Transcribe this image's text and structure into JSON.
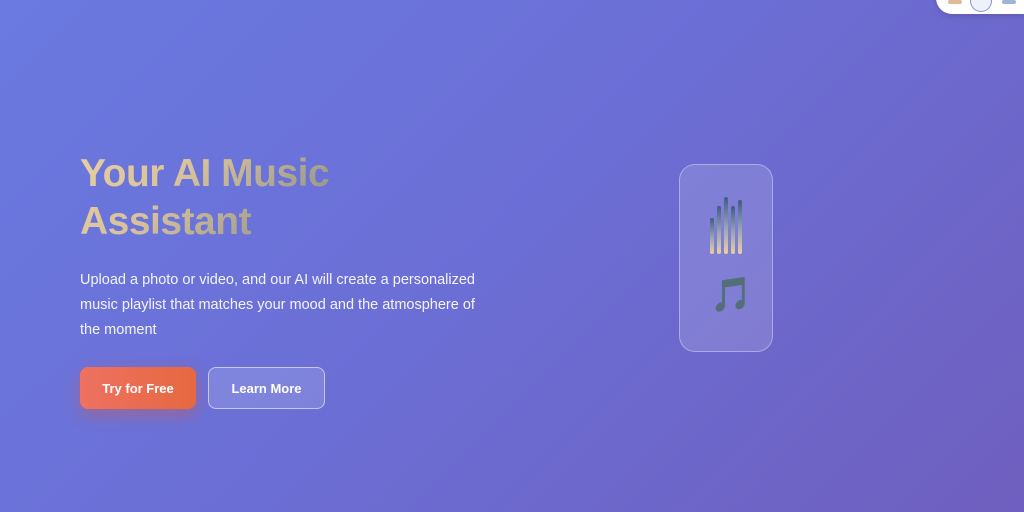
{
  "hero": {
    "title_line1": "Your AI Music",
    "title_line2": "Assistant",
    "subtitle": "Upload a photo or video, and our AI will create a personalized music playlist that matches your mood and the atmosphere of the moment",
    "primary_button": "Try for Free",
    "secondary_button": "Learn More"
  },
  "visual": {
    "note_glyph": "🎵",
    "equalizer_icon": "equalizer-bars",
    "equalizer_levels": [
      0.6,
      0.8,
      0.95,
      0.8,
      0.9
    ]
  },
  "colors": {
    "background_start": "#6a7ae0",
    "background_end": "#6f5fbf",
    "primary_button": "#e96d52",
    "title_gradient_start": "#e8cfa0",
    "title_gradient_end": "#3f5a86"
  }
}
